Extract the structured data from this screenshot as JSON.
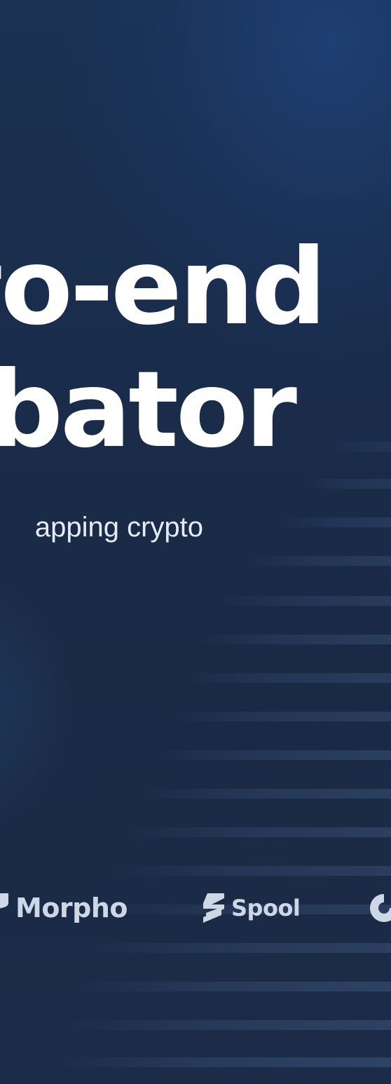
{
  "hero": {
    "headline_line1": "to-end",
    "headline_line2": "ubator",
    "subtitle": "apping crypto"
  },
  "partners": [
    {
      "name": "Morpho",
      "icon": "morpho-logo-icon"
    },
    {
      "name": "Spool",
      "icon": "spool-logo-icon"
    },
    {
      "name": "",
      "icon": "partner-logo-icon"
    }
  ],
  "colors": {
    "background_top": "#1a3153",
    "background_bottom": "#1a2a45",
    "headline": "#ffffff",
    "subtitle": "#e6ebf3",
    "logo": "#cdd7e6"
  }
}
